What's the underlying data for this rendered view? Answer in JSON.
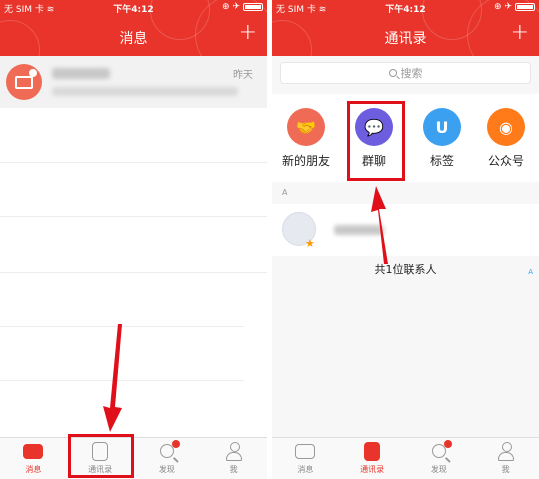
{
  "status_bar": {
    "carrier": "无 SIM 卡 ≋",
    "time": "下午4:12",
    "right": "⊕ ✈"
  },
  "messages_screen": {
    "title": "消息",
    "add_button": "+",
    "item": {
      "time": "昨天"
    }
  },
  "contacts_screen": {
    "title": "通讯录",
    "add_button": "+",
    "search_placeholder": "搜索",
    "functions": [
      {
        "label": "新的朋友",
        "icon": "handshake-icon"
      },
      {
        "label": "群聊",
        "icon": "group-chat-icon"
      },
      {
        "label": "标签",
        "icon": "tag-icon"
      },
      {
        "label": "公众号",
        "icon": "official-account-icon"
      }
    ],
    "section_letter": "A",
    "contact_count": "共1位联系人",
    "index_letter": "A"
  },
  "tabbar": {
    "tabs": [
      {
        "label": "消息",
        "icon": "message-icon"
      },
      {
        "label": "通讯录",
        "icon": "contacts-icon"
      },
      {
        "label": "发现",
        "icon": "discover-icon"
      },
      {
        "label": "我",
        "icon": "me-icon"
      }
    ]
  },
  "colors": {
    "header_red": "#e8342a",
    "annotation_red": "#e0101a"
  }
}
